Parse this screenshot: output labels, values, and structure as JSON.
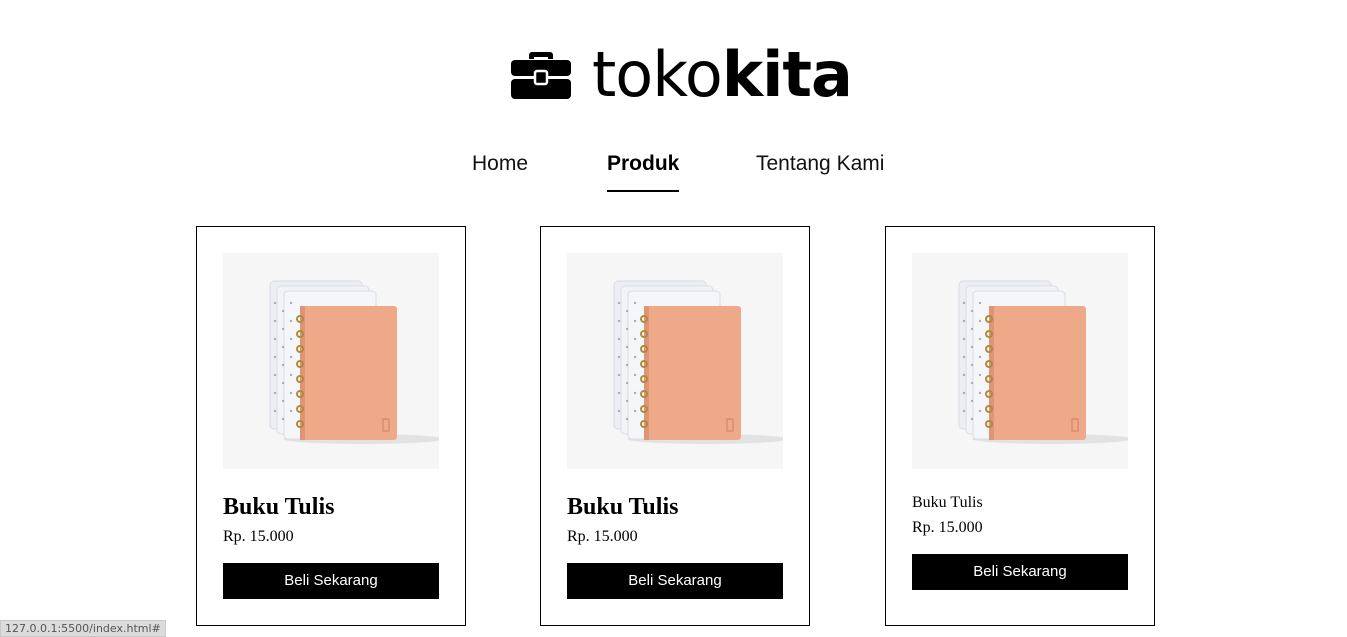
{
  "logo": {
    "text_light": "toko",
    "text_bold": "kita",
    "icon": "toolbox-icon"
  },
  "nav": {
    "items": [
      {
        "label": "Home",
        "active": false
      },
      {
        "label": "Produk",
        "active": true
      },
      {
        "label": "Tentang Kami",
        "active": false
      }
    ]
  },
  "products": [
    {
      "title": "Buku Tulis",
      "price": "Rp. 15.000",
      "button": "Beli Sekarang",
      "image": "notebook-image"
    },
    {
      "title": "Buku Tulis",
      "price": "Rp. 15.000",
      "button": "Beli Sekarang",
      "image": "notebook-image"
    },
    {
      "title": "Buku Tulis",
      "price": "Rp. 15.000",
      "button": "Beli Sekarang",
      "image": "notebook-image"
    }
  ],
  "status_bar": {
    "url": "127.0.0.1:5500/index.html#"
  },
  "colors": {
    "background": "#ffffff",
    "text": "#000000",
    "button_bg": "#000000",
    "button_text": "#ffffff",
    "notebook_cover": "#eeaa88",
    "image_bg": "#f6f6f6"
  }
}
